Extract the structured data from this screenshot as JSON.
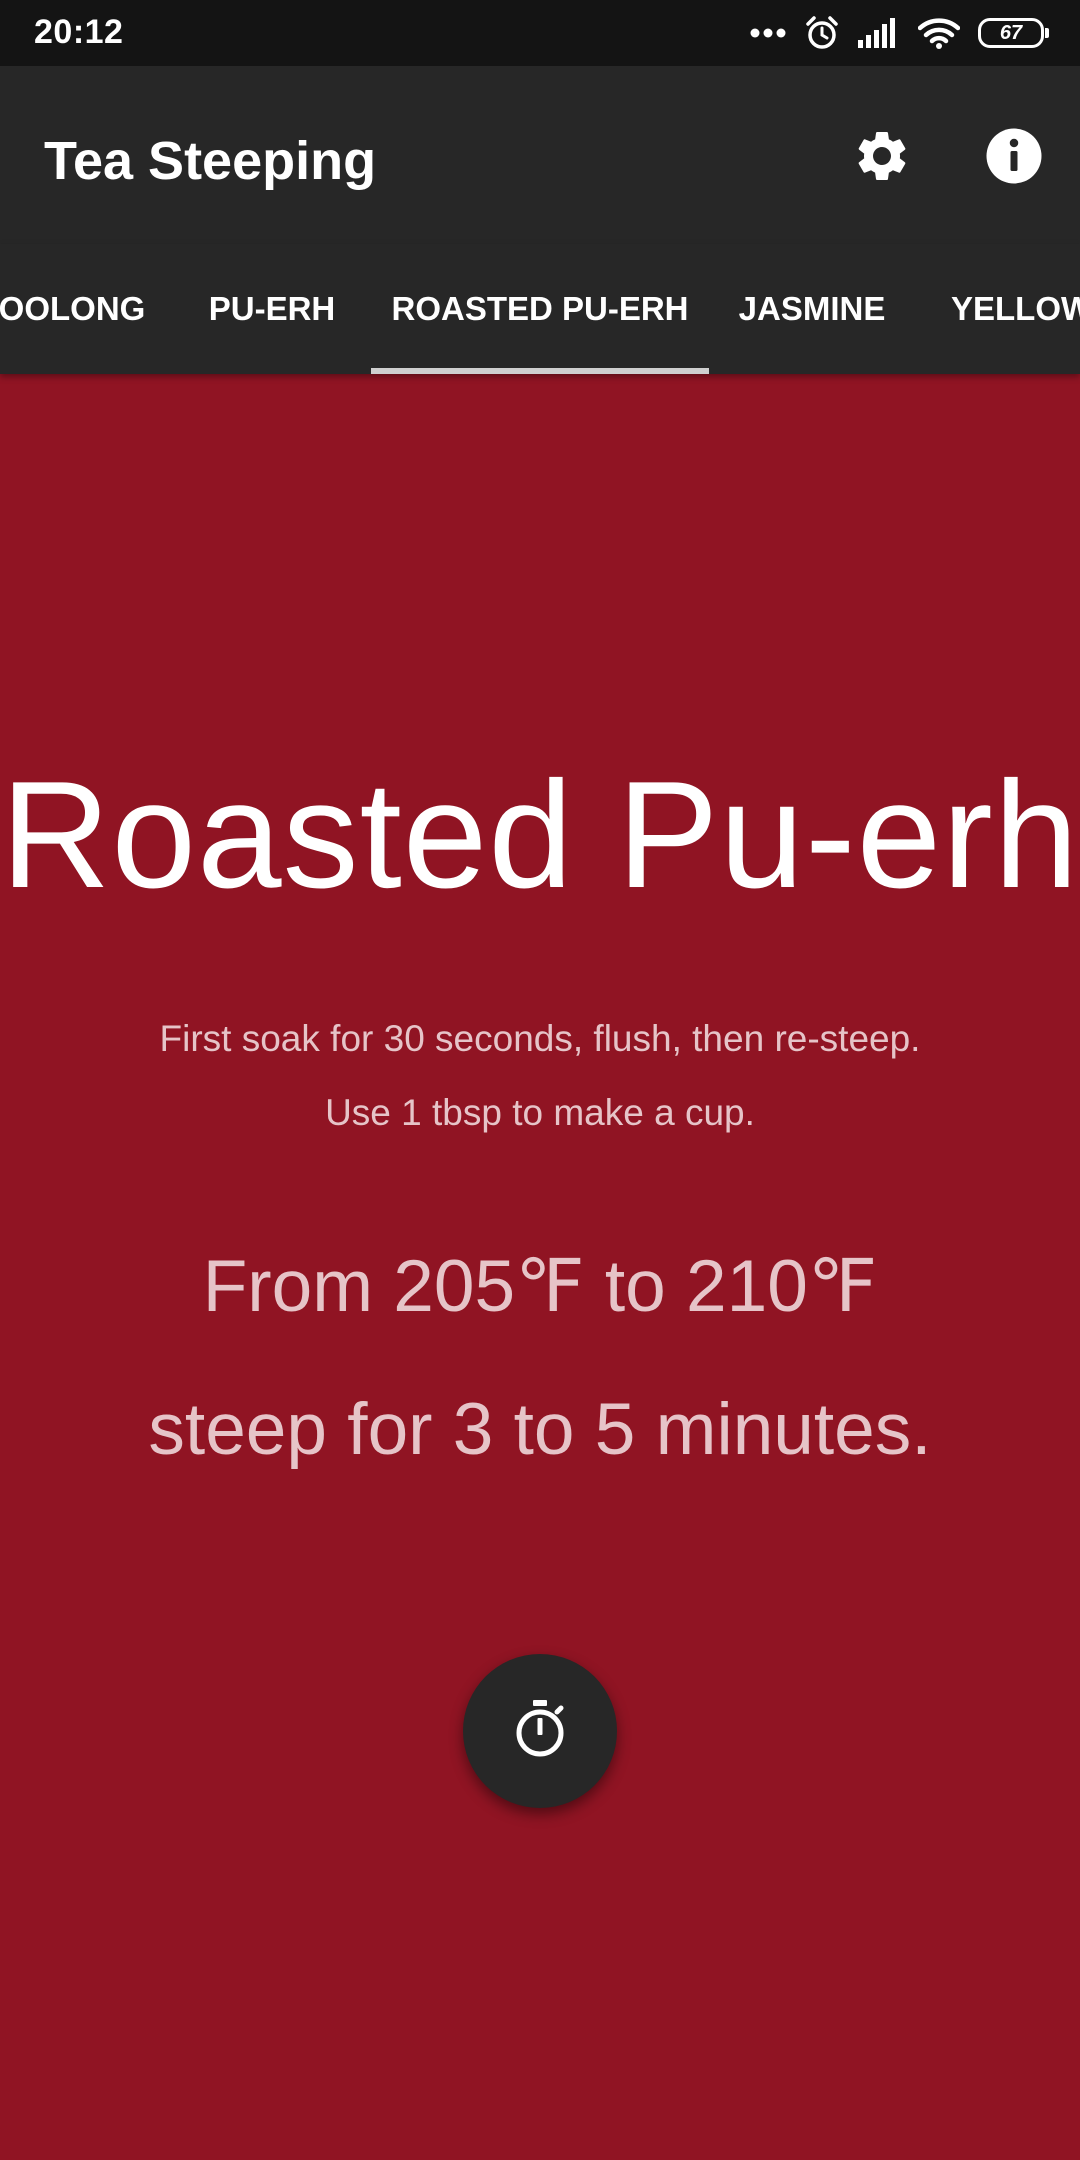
{
  "status_bar": {
    "time": "20:12",
    "battery_level": "67",
    "icons": [
      "more-dots-icon",
      "alarm-icon",
      "signal-icon",
      "wifi-icon",
      "battery-icon"
    ]
  },
  "app_bar": {
    "title": "Tea Steeping",
    "actions": [
      "settings-icon",
      "info-icon"
    ]
  },
  "tabs": {
    "items": [
      {
        "label": "OOLONG"
      },
      {
        "label": "PU-ERH"
      },
      {
        "label": "ROASTED PU-ERH"
      },
      {
        "label": "JASMINE"
      },
      {
        "label": "YELLOW"
      }
    ],
    "selected": "ROASTED PU-ERH"
  },
  "tea": {
    "name": "Roasted Pu-erh",
    "tips": [
      "First soak for 30 seconds, flush, then re-steep.",
      "Use 1 tbsp to make a cup."
    ],
    "temperature_line": "From 205℉ to 210℉",
    "time_line": "steep for 3 to 5 minutes."
  },
  "timer_button": {
    "icon": "stopwatch-icon"
  },
  "colors": {
    "background": "#901423",
    "app_bar": "#272727",
    "status_bar": "#141414",
    "tab_indicator": "#cfcfcf"
  }
}
